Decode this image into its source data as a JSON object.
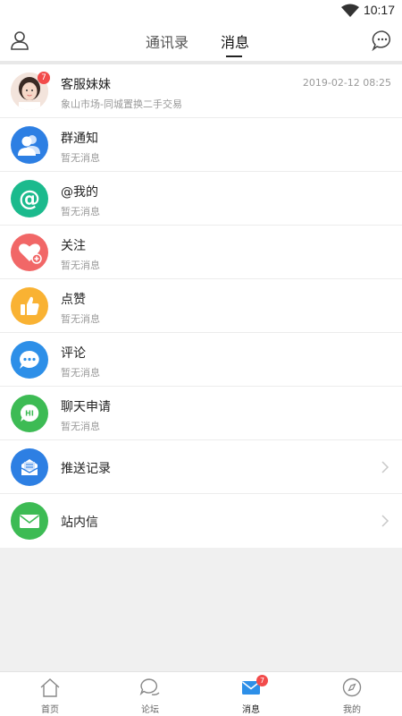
{
  "status_bar": {
    "time": "10:17"
  },
  "header": {
    "tabs": [
      {
        "label": "通讯录"
      },
      {
        "label": "消息"
      }
    ]
  },
  "messages": [
    {
      "title": "客服妹妹",
      "subtitle": "象山市场-同城置换二手交易",
      "time": "2019-02-12 08:25",
      "badge": "7",
      "icon": "avatar"
    },
    {
      "title": "群通知",
      "subtitle": "暂无消息",
      "icon": "group-icon",
      "color": "#2d7fe3"
    },
    {
      "title": "@我的",
      "subtitle": "暂无消息",
      "icon": "at-icon",
      "color": "#1bba8d"
    },
    {
      "title": "关注",
      "subtitle": "暂无消息",
      "icon": "heart-plus-icon",
      "color": "#f16767"
    },
    {
      "title": "点赞",
      "subtitle": "暂无消息",
      "icon": "thumbs-up-icon",
      "color": "#f9b233"
    },
    {
      "title": "评论",
      "subtitle": "暂无消息",
      "icon": "comment-icon",
      "color": "#2d8fe8"
    },
    {
      "title": "聊天申请",
      "subtitle": "暂无消息",
      "icon": "hi-chat-icon",
      "color": "#3dbb54"
    },
    {
      "title": "推送记录",
      "icon": "push-record-icon",
      "color": "#2d7fe3"
    },
    {
      "title": "站内信",
      "icon": "mail-icon",
      "color": "#3dbb54"
    }
  ],
  "bottom_nav": [
    {
      "label": "首页",
      "icon": "home-icon"
    },
    {
      "label": "论坛",
      "icon": "forum-icon"
    },
    {
      "label": "消息",
      "icon": "message-icon",
      "badge": "7",
      "active": true
    },
    {
      "label": "我的",
      "icon": "profile-compass-icon"
    }
  ]
}
